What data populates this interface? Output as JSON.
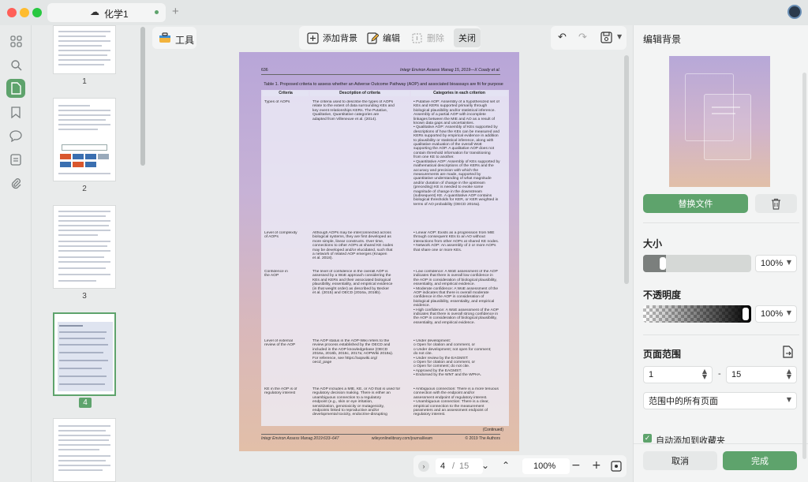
{
  "tab": {
    "title": "化学1",
    "add": "+"
  },
  "toolbar": {
    "tools": "工具",
    "add_bg": "添加背景",
    "edit": "编辑",
    "delete": "删除",
    "close": "关闭"
  },
  "thumbnails": [
    {
      "label": "1"
    },
    {
      "label": "2"
    },
    {
      "label": "3"
    },
    {
      "label": "4"
    },
    {
      "label": ""
    }
  ],
  "page": {
    "header_left": "636",
    "header_right": "Integr Environ Assess Manag 15, 2019—X Coady et al.",
    "table_title": "Table 1. Proposed criteria to assess whether an Adverse Outcome Pathway (AOP) and associated bioassays are fit for purpose",
    "columns": [
      "Criteria",
      "Description of criteria",
      "Categories in each criterion"
    ],
    "rows": [
      {
        "criteria": "Types of AOPs",
        "description": "The criteria used to describe the types of AOPs\nrelate to the extent of data surrounding KEs and\nkey event relationships KERs. The Putative,\nQualitative, Quantitative categories are\nadapted from Villeneuve et al. (2014).",
        "categories": "• Putative AOP: Assembly of a hypothesized set of\n  KEs and KERs supported primarily through\n  biological plausibility and/or statistical inference.\n  Assembly of a partial AOP with incomplete\n  linkages between the MIE and AO as a result of\n  known data gaps and uncertainties.\n• Qualitative AOP: Assembly of KEs supported by\n  descriptions of how the KEs can be measured and\n  KERs supported by empirical evidence in addition\n  to plausibility or statistical inference, along with\n  qualitative evaluation of the overall WoE\n  supporting the AOP. A qualitative AOP does not\n  contain threshold information for transitioning\n  from one KE to another.\n• Quantitative AOP: Assembly of KEs supported by\n  mathematical descriptions of the KERs and the\n  accuracy and precision with which the\n  measurements are made, supported by\n  quantitative understanding of what magnitude\n  and/or duration of change in the upstream\n  (preceding) KE is needed to evoke some\n  magnitude of change in the downstream\n  (subsequent) KE. A quantitative AOP contains\n  biological thresholds for KER, or KER weighted in\n  terms of AO probability (OECD 2016a)."
      },
      {
        "criteria": "Level of complexity\nof AOPs",
        "description": "Although AOPs may be interconnected across\nbiological systems, they are first developed as\nmore simple, linear constructs. Over time,\nconnections to other AOPs at shared KE nodes\nmay be developed and/or elucidated, such that\na network of related AOP emerges (Knapen\net al. 2018).",
        "categories": "• Linear AOP: Exists as a progression from MIE\n  through consequent KEs to an AO without\n  interactions from other AOPs at shared KE nodes.\n• Network AOP: An assembly of 2 or more AOPs\n  that share one or more KEs."
      },
      {
        "criteria": "Confidence in\nthe AOP",
        "description": "The level of confidence in the overall AOP is\nassessed by a WoE approach considering the\nKEs and KERs and their associated biological\nplausibility, essentiality, and empirical evidence\n(in that weight order) as described by Becker\net al. (2015) and OECD (2016a, 2016b).",
        "categories": "• Low confidence: A WoE assessment of the AOP\n  indicates that there is overall low confidence in\n  the AOP in consideration of biological plausibility,\n  essentiality, and empirical evidence.\n• Moderate confidence: A WoE assessment of the\n  AOP indicates that there is overall moderate\n  confidence in the AOP in consideration of\n  biological plausibility, essentiality, and empirical\n  evidence.\n• High confidence: A WoE assessment of the AOP\n  indicates that there is overall strong confidence in\n  the AOP in consideration of biological plausibility,\n  essentiality, and empirical evidence."
      },
      {
        "criteria": "Level of external\nreview of the AOP",
        "description": "The AOP status in the AOP-Wiki refers to the\nreview process established by the OECD and\nincluded in the AOP knowledgebase (OECD\n2016a, 2016b, 2016c, 2017a; AOPWiki 2019a).\nFor reference, see https://aopwiki.org/\noecd_page",
        "categories": "• Under development:\n    o Open for citation and comment, or\n    o Under development; not open for comment;\n      do not cite.\n• Under review by the EAGMST:\n    o Open for citation and comment, or\n    o Open for comment; do not cite.\n• Approved by the EAGMST.\n• Endorsed by the WNT and the WPHA."
      },
      {
        "criteria": "KE in the AOP is of\nregulatory interest",
        "description": "The AOP includes a MIE, KE, or AO that is used for\nregulatory decision making. There is either an\nunambiguous connection to a regulatory\nendpoint (e.g., skin or eye irritation,\nsensitization, genotoxicity or mutagenicity,\nendpoints linked to reproductive and/or\ndevelopmental toxicity, endocrine-disrupting",
        "categories": "• Ambiguous connection: There is a more tenuous\n  connection with the endpoint and/or\n  assessment endpoint of regulatory interest.\n• Unambiguous connection: There is a clear,\n  empirical connection to the measurement\n  parameters and an assessment endpoint of\n  regulatory interest."
      }
    ],
    "continued": "(Continued)",
    "footer_left": "Integr Environ Assess Manag 2019:633–647",
    "footer_center": "wileyonlinelibrary.com/journal/ieam",
    "footer_right": "© 2019 The Authors"
  },
  "nav": {
    "current": "4",
    "sep": "/",
    "total": "15",
    "zoom": "100%"
  },
  "panel": {
    "title": "编辑背景",
    "replace": "替换文件",
    "size_label": "大小",
    "size_value": "100%",
    "size_level": 0.15,
    "opacity_label": "不透明度",
    "opacity_value": "100%",
    "opacity_level": 1.0,
    "range_label": "页面范围",
    "range_from": "1",
    "range_dash": "-",
    "range_to": "15",
    "range_option": "范围中的所有页面",
    "auto_add": "自动添加到收藏夹",
    "cancel": "取消",
    "done": "完成"
  },
  "colors": {
    "accent": "#5ea36c",
    "rail_bg": "#e9ebeb",
    "panel_bg": "#f3f4f4"
  }
}
